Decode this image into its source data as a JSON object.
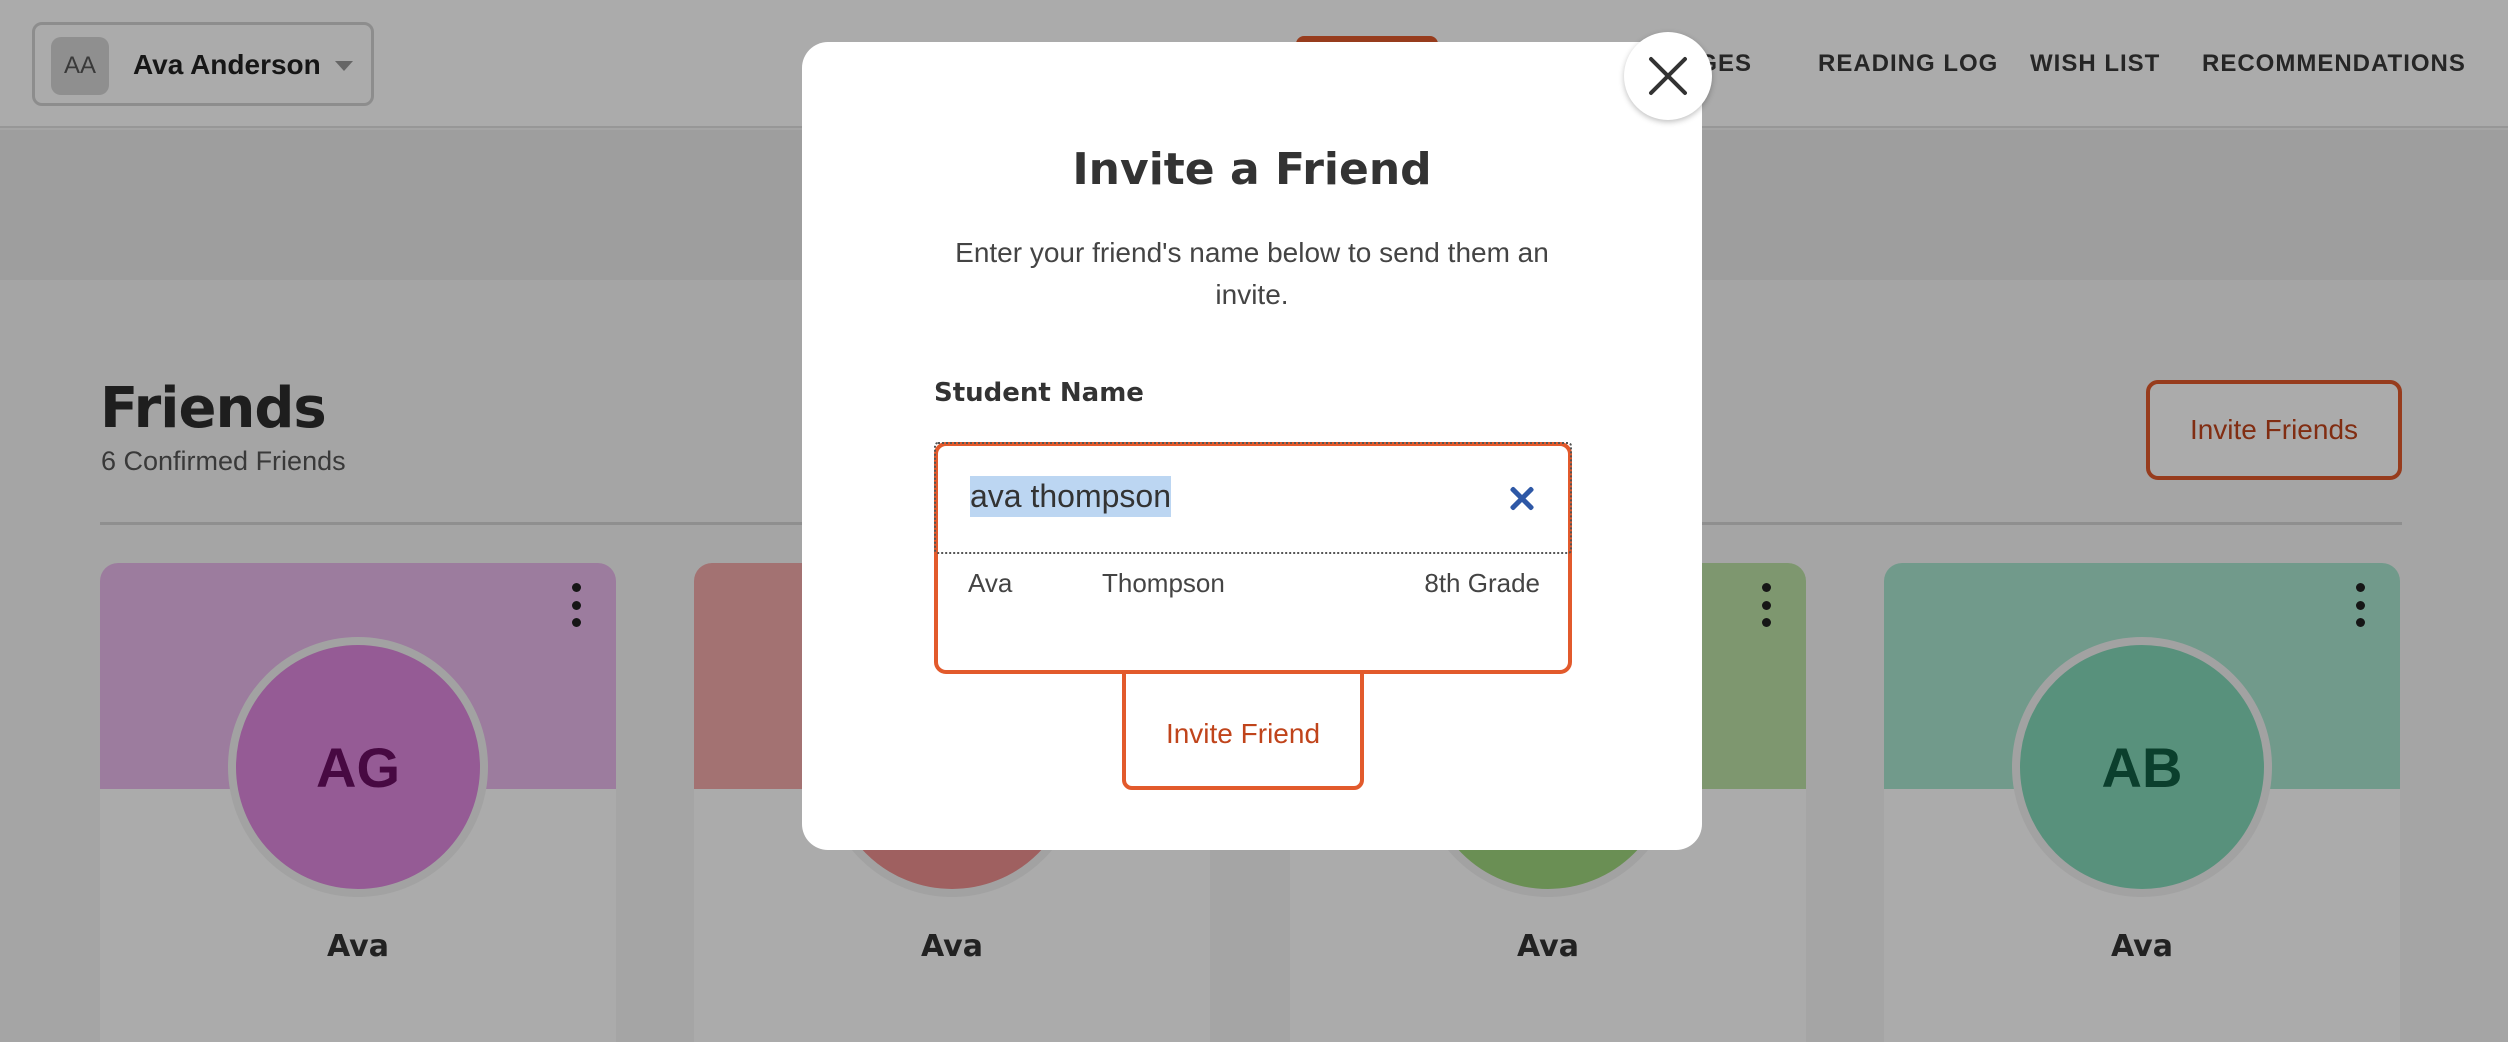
{
  "header": {
    "user": {
      "initials": "AA",
      "name": "Ava Anderson"
    },
    "nav": [
      "BADGES",
      "READING LOG",
      "WISH LIST",
      "RECOMMENDATIONS"
    ],
    "nav_visible": [
      "DGES",
      "READING LOG",
      "WISH LIST",
      "RECOMMENDATIONS"
    ]
  },
  "friends": {
    "title": "Friends",
    "count_text": "6 Confirmed Friends",
    "invite_button": "Invite Friends",
    "cards": [
      {
        "initials": "AG",
        "name": "Ava",
        "color": "#de88de"
      },
      {
        "initials": "",
        "name": "Ava",
        "color": "#ee8f8f"
      },
      {
        "initials": "",
        "name": "Ava",
        "color": "#9fd57e"
      },
      {
        "initials": "AB",
        "name": "Ava",
        "color": "#84d9ba"
      }
    ]
  },
  "modal": {
    "title": "Invite a Friend",
    "description": "Enter your friend's name below to send them an invite.",
    "field_label": "Student Name",
    "search_value": "ava thompson",
    "results": [
      {
        "first": "Ava",
        "last": "Thompson",
        "grade": "8th Grade"
      }
    ],
    "submit_button": "Invite Friend"
  },
  "colors": {
    "accent": "#e25a2c",
    "clear_icon": "#2e58a6",
    "selection": "#bcd6f2"
  }
}
